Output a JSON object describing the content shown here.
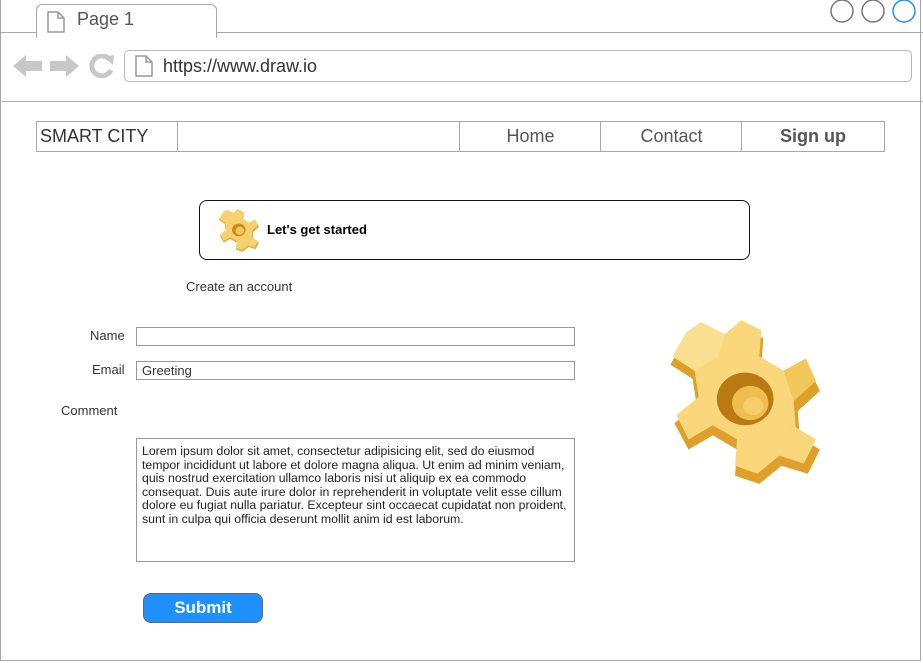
{
  "browser": {
    "tab_title": "Page 1",
    "url": "https://www.draw.io"
  },
  "site_nav": {
    "brand": "SMART CITY",
    "items": [
      {
        "label": "Home"
      },
      {
        "label": "Contact"
      },
      {
        "label": "Sign up"
      }
    ]
  },
  "banner": {
    "text": "Let's get started",
    "icon": "gear-icon"
  },
  "form": {
    "heading": "Create an account",
    "name_label": "Name",
    "name_value": "",
    "email_label": "Email",
    "email_value": "Greeting",
    "comment_label": "Comment",
    "comment_value": "Lorem ipsum dolor sit amet, consectetur adipisicing elit, sed do eiusmod tempor incididunt ut labore et dolore magna aliqua. Ut enim ad minim veniam, quis nostrud exercitation ullamco laboris nisi ut aliquip ex ea commodo consequat. Duis aute irure dolor in reprehenderit in voluptate velit esse cillum dolore eu fugiat nulla pariatur. Excepteur sint occaecat cupidatat non proident, sunt in culpa qui officia deserunt mollit anim id est laborum.",
    "submit_label": "Submit"
  },
  "colors": {
    "accent": "#1e90ff",
    "gear_light": "#f9d87a",
    "gear_dark": "#e0a62c"
  }
}
